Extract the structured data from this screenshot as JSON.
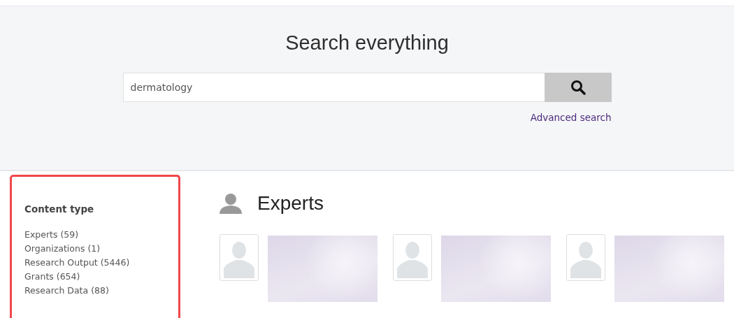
{
  "search": {
    "title": "Search everything",
    "value": "dermatology",
    "advanced_link": "Advanced search"
  },
  "sidebar": {
    "highlighted": true,
    "heading": "Content type",
    "items": [
      {
        "label": "Experts (59)"
      },
      {
        "label": "Organizations (1)"
      },
      {
        "label": "Research Output (5446)"
      },
      {
        "label": "Grants (654)"
      },
      {
        "label": "Research Data (88)"
      }
    ]
  },
  "section": {
    "title": "Experts",
    "cards": [
      {
        "kind": "redacted"
      },
      {
        "kind": "redacted"
      },
      {
        "kind": "redacted"
      }
    ]
  }
}
